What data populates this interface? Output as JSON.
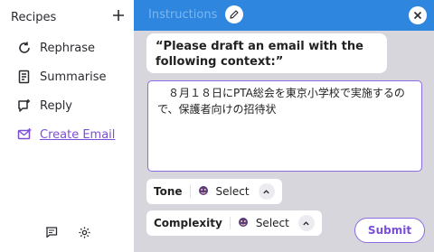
{
  "sidebar": {
    "title": "Recipes",
    "add_icon": "plus-icon",
    "items": [
      {
        "label": "Rephrase",
        "icon": "rephrase-icon"
      },
      {
        "label": "Summarise",
        "icon": "document-icon"
      },
      {
        "label": "Reply",
        "icon": "reply-icon"
      },
      {
        "label": "Create Email",
        "icon": "email-icon",
        "active": true
      }
    ],
    "footer": [
      "feedback-icon",
      "gear-icon"
    ]
  },
  "panel": {
    "title": "Instructions",
    "prompt": "“Please draft an email with the following context:”",
    "input_value": "　８月１８日にPTA総会を東京小学校で実施するので、保護者向けの招待状",
    "tone": {
      "label": "Tone",
      "value": "Select"
    },
    "complexity": {
      "label": "Complexity",
      "value": "Select"
    },
    "submit_label": "Submit"
  },
  "colors": {
    "accent": "#7a4fd6",
    "topbar": "#2e86de",
    "background": "#d6d6dc"
  }
}
